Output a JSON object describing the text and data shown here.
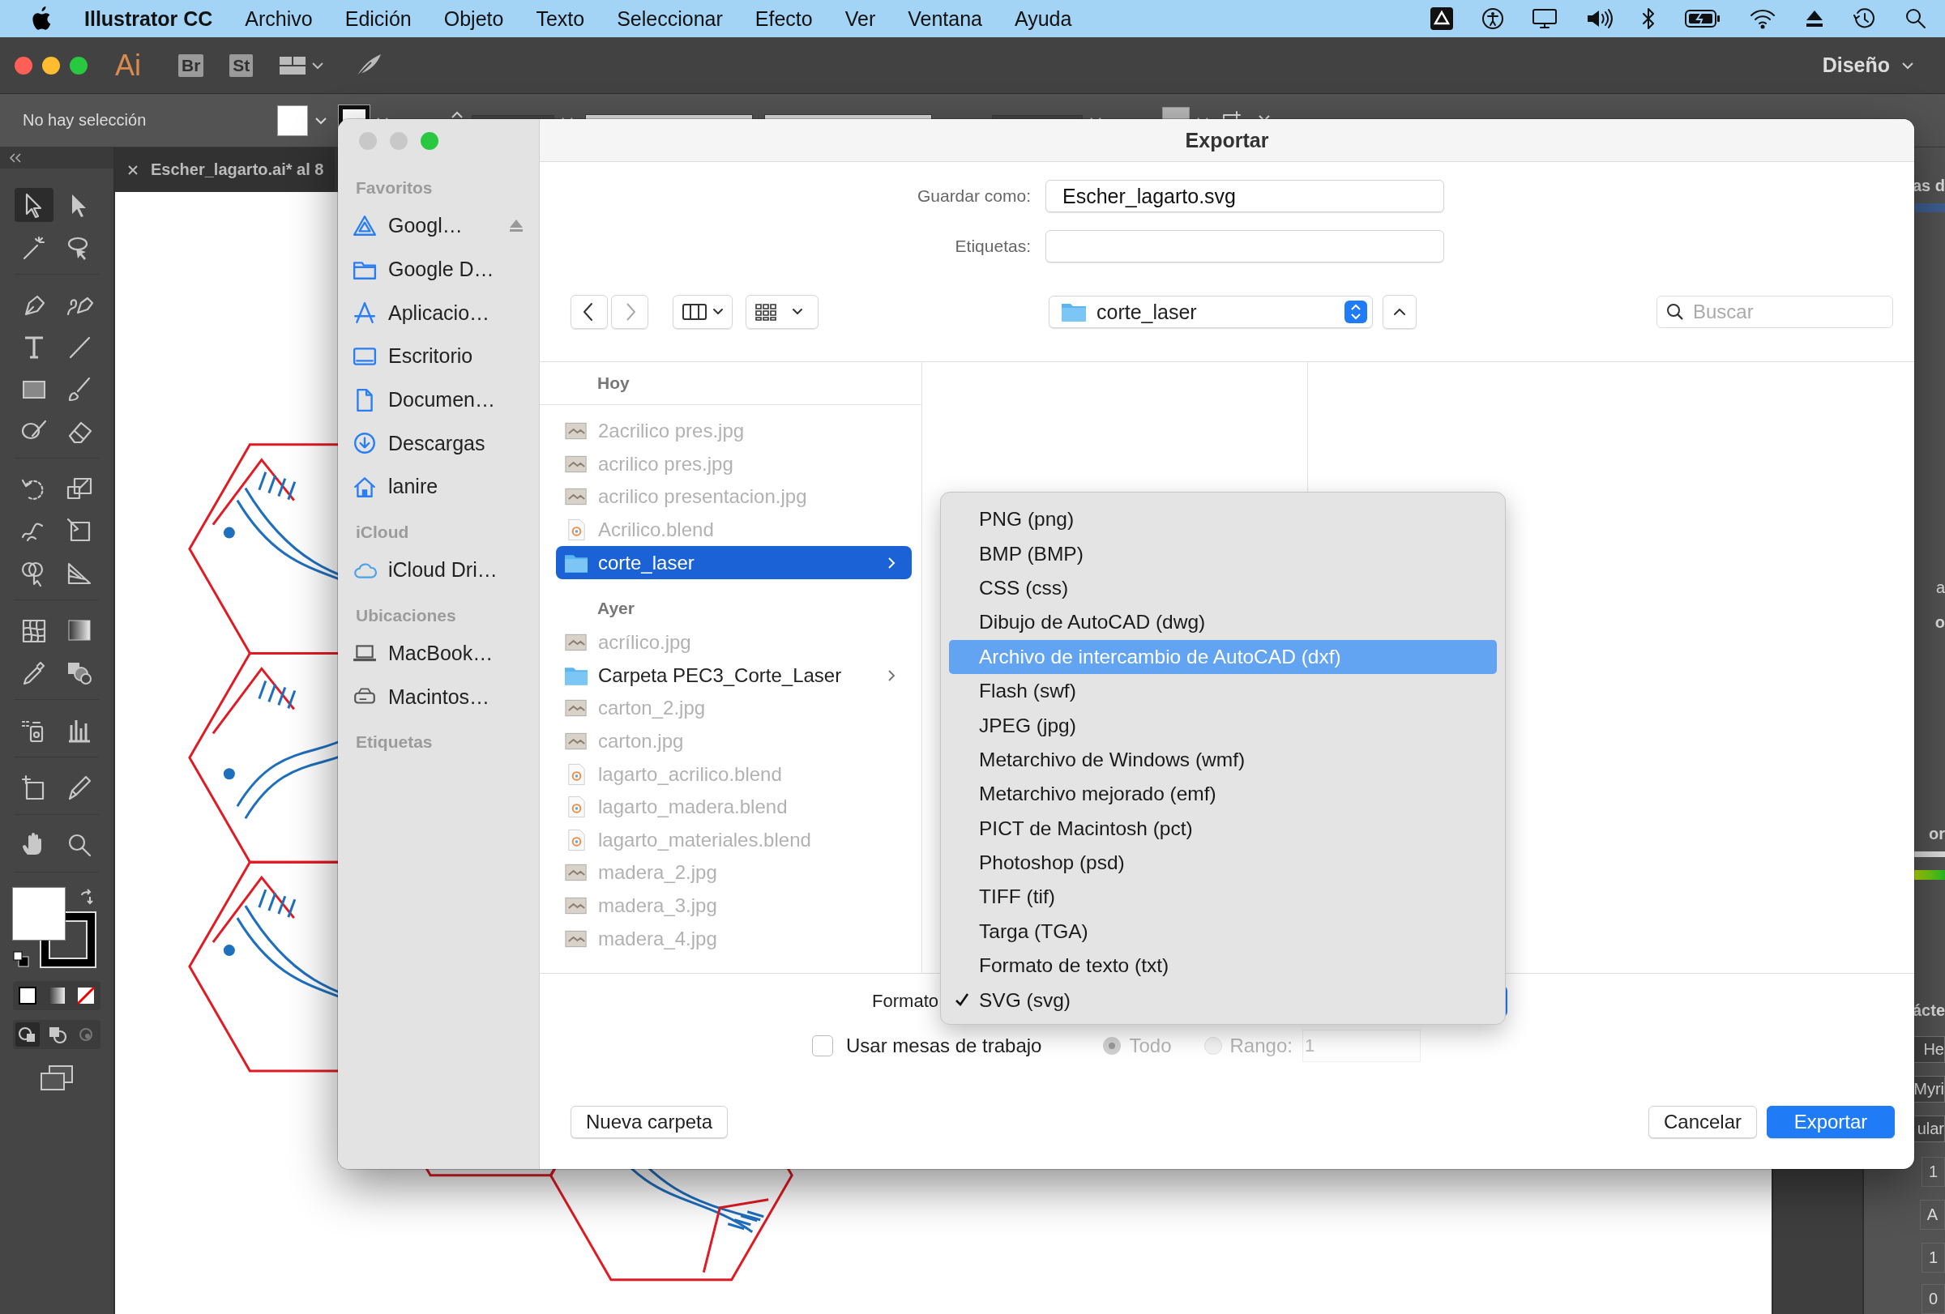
{
  "menu_bar": {
    "app": "Illustrator CC",
    "items": [
      "Archivo",
      "Edición",
      "Objeto",
      "Texto",
      "Seleccionar",
      "Efecto",
      "Ver",
      "Ventana",
      "Ayuda"
    ]
  },
  "app_bar": {
    "logo": "Ai",
    "apps": [
      "Br",
      "St"
    ],
    "workspace": "Diseño"
  },
  "control_bar": {
    "selection": "No hay selección",
    "items": [
      {
        "kind": "fill_swatch"
      },
      {
        "kind": "stroke_swatch"
      },
      {
        "kind": "stepper"
      },
      {
        "kind": "stroke"
      },
      {
        "kind": "stroke"
      },
      {
        "kind": "field"
      },
      {
        "kind": "style_swatch"
      }
    ]
  },
  "document_tab": {
    "title": "Escher_lagarto.ai* al 8"
  },
  "right_panel": [
    {
      "kind": "tab",
      "text": "as d"
    },
    {
      "kind": "text",
      "text": "a"
    },
    {
      "kind": "tab",
      "text": "o"
    },
    {
      "kind": "tab",
      "text": "or"
    },
    {
      "kind": "tab",
      "text": "ácte"
    },
    {
      "kind": "field",
      "text": "He"
    },
    {
      "kind": "field",
      "text": "Myri"
    },
    {
      "kind": "field",
      "text": "ular"
    },
    {
      "kind": "stepper",
      "text": "1"
    },
    {
      "kind": "stepper",
      "text": "A"
    },
    {
      "kind": "stepper",
      "text": "1"
    },
    {
      "kind": "stepper",
      "text": "0"
    }
  ],
  "dialog": {
    "title": "Exportar",
    "sidebar": [
      {
        "heading": "Favoritos",
        "items": [
          {
            "label": "Googl…",
            "kind": "drive",
            "eject": true
          },
          {
            "label": "Google D…",
            "kind": "folder",
            "eject": false
          },
          {
            "label": "Aplicacio…",
            "kind": "apps",
            "eject": false
          },
          {
            "label": "Escritorio",
            "kind": "desktop",
            "eject": false
          },
          {
            "label": "Documen…",
            "kind": "document",
            "eject": false
          },
          {
            "label": "Descargas",
            "kind": "download",
            "eject": false
          },
          {
            "label": "lanire",
            "kind": "home",
            "eject": false
          }
        ]
      },
      {
        "heading": "iCloud",
        "items": [
          {
            "label": "iCloud Dri…",
            "kind": "cloud",
            "eject": false
          }
        ]
      },
      {
        "heading": "Ubicaciones",
        "items": [
          {
            "label": "MacBook…",
            "kind": "laptop",
            "eject": false
          },
          {
            "label": "Macintos…",
            "kind": "disk",
            "eject": false
          }
        ]
      },
      {
        "heading": "Etiquetas"
      }
    ],
    "save_as": {
      "label": "Guardar como:",
      "value": "Escher_lagarto.svg"
    },
    "tags": {
      "label": "Etiquetas:"
    },
    "location": "corte_laser",
    "search": {
      "placeholder": "Buscar"
    },
    "file_groups": [
      {
        "heading": "Hoy",
        "files": [
          {
            "name": "2acrilico pres.jpg",
            "kind": "image",
            "disabled": true,
            "selected": false,
            "has_contents": false
          },
          {
            "name": "acrilico pres.jpg",
            "kind": "image",
            "disabled": true,
            "selected": false,
            "has_contents": false
          },
          {
            "name": "acrilico presentacion.jpg",
            "kind": "image",
            "disabled": true,
            "selected": false,
            "has_contents": false
          },
          {
            "name": "Acrilico.blend",
            "kind": "blend",
            "disabled": true,
            "selected": false,
            "has_contents": false
          },
          {
            "name": "corte_laser",
            "kind": "folder",
            "disabled": false,
            "selected": true,
            "has_contents": true
          }
        ]
      },
      {
        "heading": "Ayer",
        "files": [
          {
            "name": "acrílico.jpg",
            "kind": "image",
            "disabled": true,
            "selected": false,
            "has_contents": false
          },
          {
            "name": "Carpeta PEC3_Corte_Laser",
            "kind": "folder",
            "disabled": false,
            "selected": false,
            "has_contents": true
          },
          {
            "name": "carton_2.jpg",
            "kind": "image",
            "disabled": true,
            "selected": false,
            "has_contents": false
          },
          {
            "name": "carton.jpg",
            "kind": "image",
            "disabled": true,
            "selected": false,
            "has_contents": false
          },
          {
            "name": "lagarto_acrilico.blend",
            "kind": "blend",
            "disabled": true,
            "selected": false,
            "has_contents": false
          },
          {
            "name": "lagarto_madera.blend",
            "kind": "blend",
            "disabled": true,
            "selected": false,
            "has_contents": false
          },
          {
            "name": "lagarto_materiales.blend",
            "kind": "blend",
            "disabled": true,
            "selected": false,
            "has_contents": false
          },
          {
            "name": "madera_2.jpg",
            "kind": "image",
            "disabled": true,
            "selected": false,
            "has_contents": false
          },
          {
            "name": "madera_3.jpg",
            "kind": "image",
            "disabled": true,
            "selected": false,
            "has_contents": false
          },
          {
            "name": "madera_4.jpg",
            "kind": "image",
            "disabled": true,
            "selected": false,
            "has_contents": false
          }
        ]
      }
    ],
    "format": {
      "label": "Formato"
    },
    "format_menu": [
      {
        "label": "PNG (png)",
        "highlighted": false,
        "checked": false
      },
      {
        "label": "BMP (BMP)",
        "highlighted": false,
        "checked": false
      },
      {
        "label": "CSS (css)",
        "highlighted": false,
        "checked": false
      },
      {
        "label": "Dibujo de AutoCAD (dwg)",
        "highlighted": false,
        "checked": false
      },
      {
        "label": "Archivo de intercambio de AutoCAD (dxf)",
        "highlighted": true,
        "checked": false
      },
      {
        "label": "Flash (swf)",
        "highlighted": false,
        "checked": false
      },
      {
        "label": "JPEG (jpg)",
        "highlighted": false,
        "checked": false
      },
      {
        "label": "Metarchivo de Windows (wmf)",
        "highlighted": false,
        "checked": false
      },
      {
        "label": "Metarchivo mejorado (emf)",
        "highlighted": false,
        "checked": false
      },
      {
        "label": "PICT de Macintosh (pct)",
        "highlighted": false,
        "checked": false
      },
      {
        "label": "Photoshop (psd)",
        "highlighted": false,
        "checked": false
      },
      {
        "label": "TIFF (tif)",
        "highlighted": false,
        "checked": false
      },
      {
        "label": "Targa (TGA)",
        "highlighted": false,
        "checked": false
      },
      {
        "label": "Formato de texto (txt)",
        "highlighted": false,
        "checked": false
      },
      {
        "label": "SVG (svg)",
        "highlighted": false,
        "checked": true
      }
    ],
    "use_artboards": {
      "label": "Usar mesas de trabajo",
      "checked": false
    },
    "range_options": [
      {
        "label": "Todo",
        "selected": true,
        "disabled": true
      },
      {
        "label": "Rango:",
        "selected": false,
        "disabled": true
      }
    ],
    "range_value": "1",
    "new_folder_button": "Nueva carpeta",
    "buttons": [
      {
        "label": "Cancelar",
        "kind": "secondary"
      },
      {
        "label": "Exportar",
        "kind": "primary"
      }
    ]
  }
}
